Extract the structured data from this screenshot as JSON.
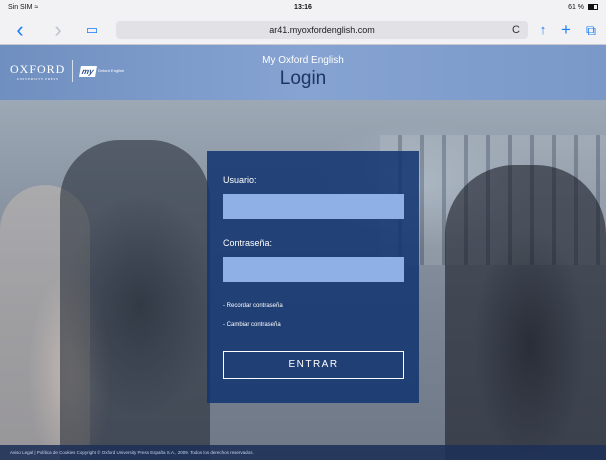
{
  "status_bar": {
    "carrier": "Sin SIM",
    "wifi": "≈",
    "time": "13:16",
    "battery": "61 %"
  },
  "browser": {
    "url": "ar41.myoxfordenglish.com",
    "back_icon": "‹",
    "forward_icon": "›",
    "bookmarks_icon": "▭",
    "reload_icon": "C",
    "share_icon": "↑",
    "add_icon": "+",
    "tabs_icon": "⧉"
  },
  "header": {
    "brand": {
      "oxford": "OXFORD",
      "press": "UNIVERSITY PRESS",
      "my": "my",
      "oxford_english": "Oxford English"
    },
    "subtitle": "My Oxford English",
    "title": "Login"
  },
  "login": {
    "username_label": "Usuario:",
    "username_value": "",
    "password_label": "Contraseña:",
    "password_value": "",
    "remember_link": "- Recordar contraseña",
    "change_link": "- Cambiar contraseña",
    "submit_label": "ENTRAR"
  },
  "footer": {
    "text": "Aviso Legal | Política de Cookies Copyright © Oxford University Press España S.A., 2009. Todos los derechos reservados."
  },
  "colors": {
    "header_band": "#86a3d2",
    "panel": "#123470",
    "input": "#8fb0e6",
    "title": "#1f3563",
    "link_blue": "#1a7cf5"
  }
}
